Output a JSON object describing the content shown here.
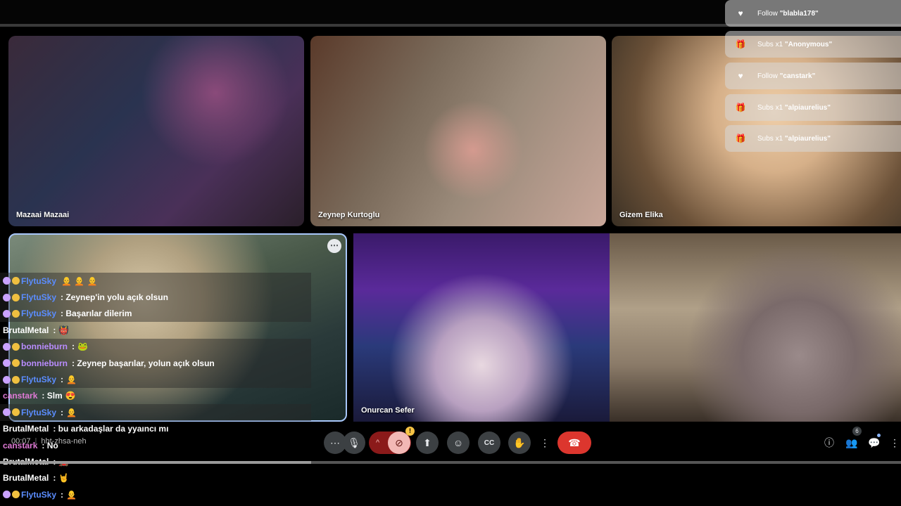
{
  "tiles": [
    {
      "name": "Mazaai Mazaai"
    },
    {
      "name": "Zeynep Kurtoglu"
    },
    {
      "name": "Gizem Elika"
    },
    {
      "name": ""
    },
    {
      "name": "Onurcan Sefer"
    },
    {
      "name": ""
    }
  ],
  "notifications": [
    {
      "icon": "heart-icon",
      "glyph": "♥",
      "label": "Follow",
      "value": "\"blabla178\""
    },
    {
      "icon": "gift-icon",
      "glyph": "🎁",
      "label": "Subs x1",
      "value": "\"Anonymous\""
    },
    {
      "icon": "heart-icon",
      "glyph": "♥",
      "label": "Follow",
      "value": "\"canstark\""
    },
    {
      "icon": "gift-icon",
      "glyph": "🎁",
      "label": "Subs x1",
      "value": "\"alpiaurelius\""
    },
    {
      "icon": "gift-icon",
      "glyph": "🎁",
      "label": "Subs x1",
      "value": "\"alpiaurelius\""
    }
  ],
  "chat": [
    {
      "user": "FlytuSky",
      "text": "",
      "emoji": "🧑‍🦲 🧑‍🦲 🧑‍🦲",
      "badges": true,
      "color": "blue",
      "bg": true
    },
    {
      "user": "FlytuSky",
      "text": ": Zeynep'in yolu açık olsun",
      "emoji": "",
      "badges": true,
      "color": "blue",
      "bg": true
    },
    {
      "user": "FlytuSky",
      "text": ": Başarılar dilerim",
      "emoji": "",
      "badges": true,
      "color": "blue",
      "bg": true
    },
    {
      "user": "BrutalMetal",
      "text": ":",
      "emoji": "👹",
      "badges": false,
      "color": "white",
      "bg": false
    },
    {
      "user": "bonnieburn",
      "text": ":",
      "emoji": "🐸",
      "badges": true,
      "color": "purple",
      "bg": true
    },
    {
      "user": "bonnieburn",
      "text": ": Zeynep başarılar, yolun açık olsun",
      "emoji": "",
      "badges": true,
      "color": "purple",
      "bg": true
    },
    {
      "user": "FlytuSky",
      "text": ":",
      "emoji": "🧑‍🦲",
      "badges": true,
      "color": "blue",
      "bg": true
    },
    {
      "user": "canstark",
      "text": ": Slm",
      "emoji": "😍",
      "badges": false,
      "color": "pink",
      "bg": false
    },
    {
      "user": "FlytuSky",
      "text": ":",
      "emoji": "🧑‍🦲",
      "badges": true,
      "color": "blue",
      "bg": true
    },
    {
      "user": "BrutalMetal",
      "text": ": bu arkadaşlar da yyaıncı mı",
      "emoji": "",
      "badges": false,
      "color": "white",
      "bg": false
    },
    {
      "user": "canstark",
      "text": ": No",
      "emoji": "",
      "badges": false,
      "color": "pink",
      "bg": false
    },
    {
      "user": "BrutalMetal",
      "text": ":",
      "emoji": "🏎️",
      "badges": false,
      "color": "white",
      "bg": false
    },
    {
      "user": "BrutalMetal",
      "text": ":",
      "emoji": "🤘",
      "badges": false,
      "color": "white",
      "bg": false
    },
    {
      "user": "FlytuSky",
      "text": ":",
      "emoji": "🧑‍🦲",
      "badges": true,
      "color": "blue",
      "bg": false
    }
  ],
  "meeting": {
    "time": "00:07",
    "code": "hht-zhsa-neh"
  },
  "progress": 0.345,
  "controls": {
    "more_dots": "⋯",
    "mic": "🎙",
    "cam_caret": "^",
    "cam": "⊘",
    "warn": "!",
    "present": "⬆",
    "emoji": "☺",
    "cc": "CC",
    "hand": "✋",
    "more": "⋮",
    "end": "☎",
    "info": "ⓘ",
    "people": "👥",
    "chat": "💬",
    "apps": "⋮⋮",
    "people_count": "6"
  },
  "tile_more": "⋯"
}
